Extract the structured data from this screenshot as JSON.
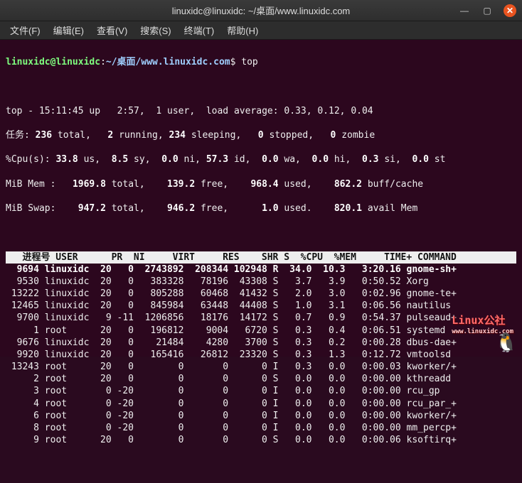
{
  "window": {
    "title": "linuxidc@linuxidc: ~/桌面/www.linuxidc.com"
  },
  "menubar": {
    "file": "文件(F)",
    "edit": "编辑(E)",
    "view": "查看(V)",
    "search": "搜索(S)",
    "terminal": "终端(T)",
    "help": "帮助(H)"
  },
  "prompt": {
    "userhost": "linuxidc@linuxidc",
    "sep": ":",
    "path": "~/桌面/www.linuxidc.com",
    "dollar": "$",
    "command": "top"
  },
  "uptime": {
    "prefix": "top - ",
    "time": "15:11:45",
    "up_label": " up ",
    "up": "2:57",
    "users": "1 user",
    "la_label": "load average:",
    "la1": "0.33",
    "la2": "0.12",
    "la3": "0.04"
  },
  "tasks": {
    "label": "任务:",
    "total": "236",
    "total_lbl": "total,",
    "running": "2",
    "running_lbl": "running,",
    "sleeping": "234",
    "sleeping_lbl": "sleeping,",
    "stopped": "0",
    "stopped_lbl": "stopped,",
    "zombie": "0",
    "zombie_lbl": "zombie"
  },
  "cpu": {
    "label": "%Cpu(s):",
    "us": "33.8",
    "us_lbl": "us,",
    "sy": "8.5",
    "sy_lbl": "sy,",
    "ni": "0.0",
    "ni_lbl": "ni,",
    "id": "57.3",
    "id_lbl": "id,",
    "wa": "0.0",
    "wa_lbl": "wa,",
    "hi": "0.0",
    "hi_lbl": "hi,",
    "si": "0.3",
    "si_lbl": "si,",
    "st": "0.0",
    "st_lbl": "st"
  },
  "mem": {
    "label": "MiB Mem :",
    "total": "1969.8",
    "total_lbl": "total,",
    "free": "139.2",
    "free_lbl": "free,",
    "used": "968.4",
    "used_lbl": "used,",
    "buff": "862.2",
    "buff_lbl": "buff/cache"
  },
  "swap": {
    "label": "MiB Swap:",
    "total": "947.2",
    "total_lbl": "total,",
    "free": "946.2",
    "free_lbl": "free,",
    "used": "1.0",
    "used_lbl": "used.",
    "avail": "820.1",
    "avail_lbl": "avail Mem"
  },
  "columns": {
    "pid": "进程号",
    "user": "USER",
    "pr": "PR",
    "ni": "NI",
    "virt": "VIRT",
    "res": "RES",
    "shr": "SHR",
    "s": "S",
    "cpu": "%CPU",
    "mem": "%MEM",
    "time": "TIME+",
    "cmd": "COMMAND"
  },
  "processes": [
    {
      "pid": "9694",
      "user": "linuxidc",
      "pr": "20",
      "ni": "0",
      "virt": "2743892",
      "res": "208344",
      "shr": "102948",
      "s": "R",
      "cpu": "34.0",
      "mem": "10.3",
      "time": "3:20.16",
      "cmd": "gnome-sh+",
      "hl": true
    },
    {
      "pid": "9530",
      "user": "linuxidc",
      "pr": "20",
      "ni": "0",
      "virt": "383328",
      "res": "78196",
      "shr": "43308",
      "s": "S",
      "cpu": "3.7",
      "mem": "3.9",
      "time": "0:50.52",
      "cmd": "Xorg"
    },
    {
      "pid": "13222",
      "user": "linuxidc",
      "pr": "20",
      "ni": "0",
      "virt": "805288",
      "res": "60468",
      "shr": "41432",
      "s": "S",
      "cpu": "2.0",
      "mem": "3.0",
      "time": "0:02.96",
      "cmd": "gnome-te+"
    },
    {
      "pid": "12465",
      "user": "linuxidc",
      "pr": "20",
      "ni": "0",
      "virt": "845984",
      "res": "63448",
      "shr": "44408",
      "s": "S",
      "cpu": "1.0",
      "mem": "3.1",
      "time": "0:06.56",
      "cmd": "nautilus"
    },
    {
      "pid": "9700",
      "user": "linuxidc",
      "pr": "9",
      "ni": "-11",
      "virt": "1206856",
      "res": "18176",
      "shr": "14172",
      "s": "S",
      "cpu": "0.7",
      "mem": "0.9",
      "time": "0:54.37",
      "cmd": "pulseaud+"
    },
    {
      "pid": "1",
      "user": "root",
      "pr": "20",
      "ni": "0",
      "virt": "196812",
      "res": "9004",
      "shr": "6720",
      "s": "S",
      "cpu": "0.3",
      "mem": "0.4",
      "time": "0:06.51",
      "cmd": "systemd"
    },
    {
      "pid": "9676",
      "user": "linuxidc",
      "pr": "20",
      "ni": "0",
      "virt": "21484",
      "res": "4280",
      "shr": "3700",
      "s": "S",
      "cpu": "0.3",
      "mem": "0.2",
      "time": "0:00.28",
      "cmd": "dbus-dae+"
    },
    {
      "pid": "9920",
      "user": "linuxidc",
      "pr": "20",
      "ni": "0",
      "virt": "165416",
      "res": "26812",
      "shr": "23320",
      "s": "S",
      "cpu": "0.3",
      "mem": "1.3",
      "time": "0:12.72",
      "cmd": "vmtoolsd"
    },
    {
      "pid": "13243",
      "user": "root",
      "pr": "20",
      "ni": "0",
      "virt": "0",
      "res": "0",
      "shr": "0",
      "s": "I",
      "cpu": "0.3",
      "mem": "0.0",
      "time": "0:00.03",
      "cmd": "kworker/+"
    },
    {
      "pid": "2",
      "user": "root",
      "pr": "20",
      "ni": "0",
      "virt": "0",
      "res": "0",
      "shr": "0",
      "s": "S",
      "cpu": "0.0",
      "mem": "0.0",
      "time": "0:00.00",
      "cmd": "kthreadd"
    },
    {
      "pid": "3",
      "user": "root",
      "pr": "0",
      "ni": "-20",
      "virt": "0",
      "res": "0",
      "shr": "0",
      "s": "I",
      "cpu": "0.0",
      "mem": "0.0",
      "time": "0:00.00",
      "cmd": "rcu_gp"
    },
    {
      "pid": "4",
      "user": "root",
      "pr": "0",
      "ni": "-20",
      "virt": "0",
      "res": "0",
      "shr": "0",
      "s": "I",
      "cpu": "0.0",
      "mem": "0.0",
      "time": "0:00.00",
      "cmd": "rcu_par_+"
    },
    {
      "pid": "6",
      "user": "root",
      "pr": "0",
      "ni": "-20",
      "virt": "0",
      "res": "0",
      "shr": "0",
      "s": "I",
      "cpu": "0.0",
      "mem": "0.0",
      "time": "0:00.00",
      "cmd": "kworker/+"
    },
    {
      "pid": "8",
      "user": "root",
      "pr": "0",
      "ni": "-20",
      "virt": "0",
      "res": "0",
      "shr": "0",
      "s": "I",
      "cpu": "0.0",
      "mem": "0.0",
      "time": "0:00.00",
      "cmd": "mm_percp+"
    },
    {
      "pid": "9",
      "user": "root",
      "pr": "20",
      "ni": "0",
      "virt": "0",
      "res": "0",
      "shr": "0",
      "s": "S",
      "cpu": "0.0",
      "mem": "0.0",
      "time": "0:00.06",
      "cmd": "ksoftirq+"
    }
  ],
  "watermark": {
    "text": "Linux公社",
    "sub": "www.linuxidc.com"
  }
}
